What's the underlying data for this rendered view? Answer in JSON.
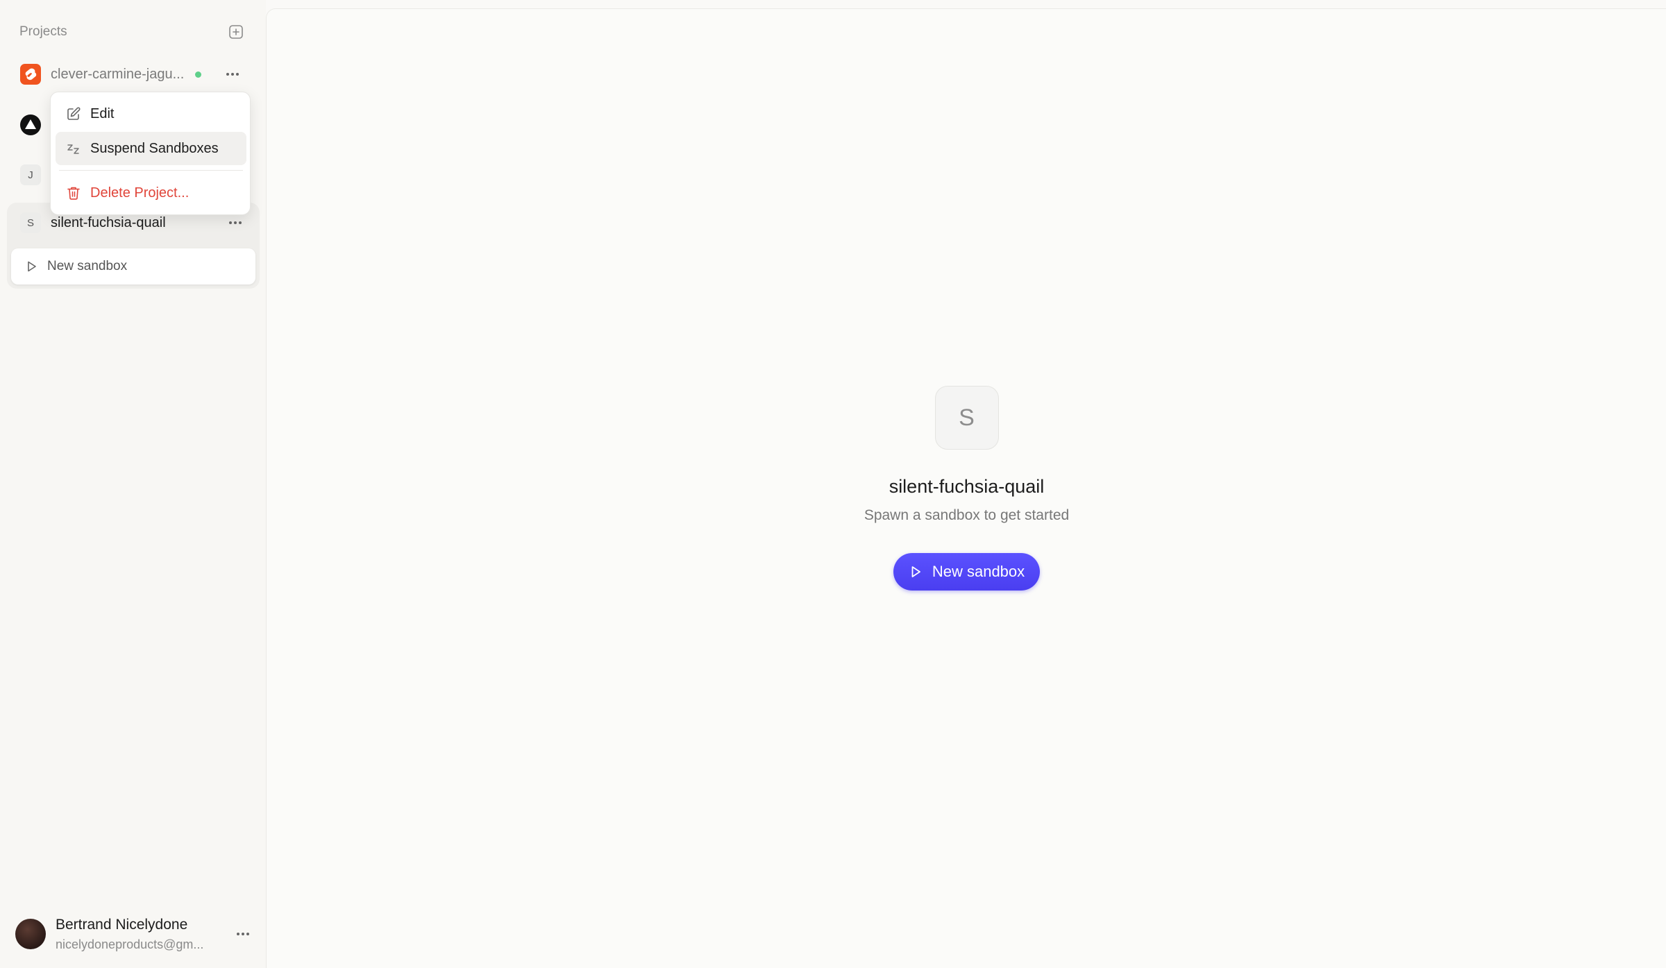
{
  "sidebar": {
    "title": "Projects",
    "add_icon": "plus-square-icon",
    "projects": [
      {
        "name": "clever-carmine-jagu...",
        "icon": "svelte-logo-icon",
        "status": "active"
      },
      {
        "name": "",
        "icon": "triangle-logo-icon"
      },
      {
        "name": "",
        "icon_letter": "J"
      },
      {
        "name": "silent-fuchsia-quail",
        "icon_letter": "S",
        "selected": true
      }
    ],
    "selected_sub_action": {
      "label": "New sandbox",
      "icon": "play-icon"
    }
  },
  "context_menu": {
    "items": [
      {
        "label": "Edit",
        "icon": "edit-icon"
      },
      {
        "label": "Suspend Sandboxes",
        "icon": "sleep-icon",
        "highlighted": true
      },
      {
        "label": "Delete Project...",
        "icon": "trash-icon",
        "danger": true
      }
    ]
  },
  "user": {
    "name": "Bertrand Nicelydone",
    "email": "nicelydoneproducts@gm...",
    "more_icon": "ellipsis-icon"
  },
  "main": {
    "avatar_letter": "S",
    "title": "silent-fuchsia-quail",
    "subtitle": "Spawn a sandbox to get started",
    "button_label": "New sandbox",
    "button_icon": "play-icon"
  },
  "colors": {
    "accent": "#4f46f5",
    "danger": "#e0453a",
    "status_active": "#5fd08a",
    "svelte": "#f0541f"
  }
}
